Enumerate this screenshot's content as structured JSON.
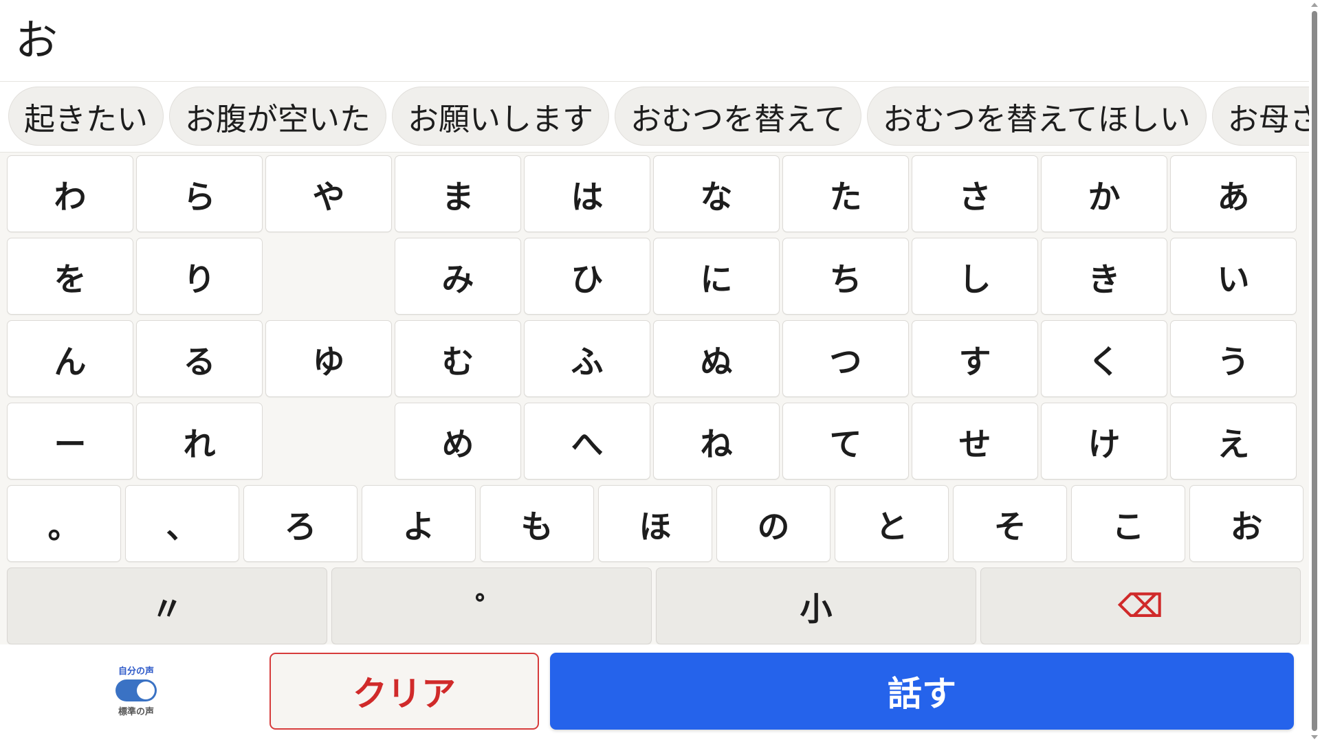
{
  "display": {
    "text": "お"
  },
  "suggestions": [
    "起きたい",
    "お腹が空いた",
    "お願いします",
    "おむつを替えて",
    "おむつを替えてほしい",
    "お母さん"
  ],
  "keyboard": {
    "row1": [
      "わ",
      "ら",
      "や",
      "ま",
      "は",
      "な",
      "た",
      "さ",
      "か",
      "あ"
    ],
    "row2": [
      "を",
      "り",
      "",
      "み",
      "ひ",
      "に",
      "ち",
      "し",
      "き",
      "い"
    ],
    "row3": [
      "ん",
      "る",
      "ゆ",
      "む",
      "ふ",
      "ぬ",
      "つ",
      "す",
      "く",
      "う"
    ],
    "row4": [
      "ー",
      "れ",
      "",
      "め",
      "へ",
      "ね",
      "て",
      "せ",
      "け",
      "え"
    ],
    "row5": [
      "。",
      "、",
      "ろ",
      "よ",
      "も",
      "ほ",
      "の",
      "と",
      "そ",
      "こ",
      "お"
    ],
    "functions": {
      "dakuten": "〃",
      "handakuten": "゜",
      "small": "小",
      "delete": "⌫"
    }
  },
  "voice": {
    "top_label": "自分の声",
    "bottom_label": "標準の声",
    "own_voice_on": true
  },
  "actions": {
    "clear": "クリア",
    "speak": "話す"
  },
  "colors": {
    "accent": "#2563eb",
    "danger": "#d02a2a",
    "toggle": "#3a72c4",
    "keyboard_bg": "#f7f6f3"
  }
}
